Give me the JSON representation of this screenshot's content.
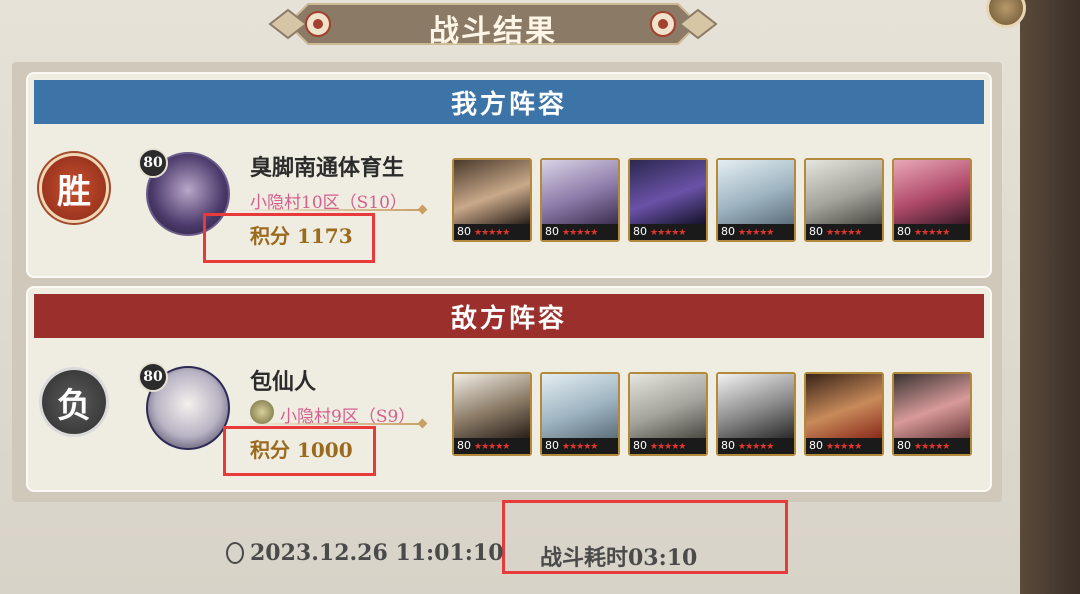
{
  "title": "战斗结果",
  "ally": {
    "header": "我方阵容",
    "result": "胜",
    "level": "80",
    "name": "臭脚南通体育生",
    "server": "小隐村10区（S10）",
    "score": "积分  1173",
    "heroes": [
      {
        "level": "80",
        "stars": "★★★★★"
      },
      {
        "level": "80",
        "stars": "★★★★★"
      },
      {
        "level": "80",
        "stars": "★★★★★"
      },
      {
        "level": "80",
        "stars": "★★★★★"
      },
      {
        "level": "80",
        "stars": "★★★★★"
      },
      {
        "level": "80",
        "stars": "★★★★★"
      }
    ]
  },
  "enemy": {
    "header": "敌方阵容",
    "result": "负",
    "level": "80",
    "name": "包仙人",
    "server": "小隐村9区（S9）",
    "score": "积分  1000",
    "heroes": [
      {
        "level": "80",
        "stars": "★★★★★"
      },
      {
        "level": "80",
        "stars": "★★★★★"
      },
      {
        "level": "80",
        "stars": "★★★★★"
      },
      {
        "level": "80",
        "stars": "★★★★★"
      },
      {
        "level": "80",
        "stars": "★★★★★"
      },
      {
        "level": "80",
        "stars": "★★★★★"
      }
    ]
  },
  "footer": {
    "timestamp": "2023.12.26 11:01:10",
    "duration": "战斗耗时03:10"
  },
  "colors": {
    "ally_header": "#3d74a8",
    "enemy_header": "#9a2f2c",
    "highlight": "#e83a3a",
    "server_text": "#d45e8c",
    "score_text": "#9b6a1c"
  }
}
